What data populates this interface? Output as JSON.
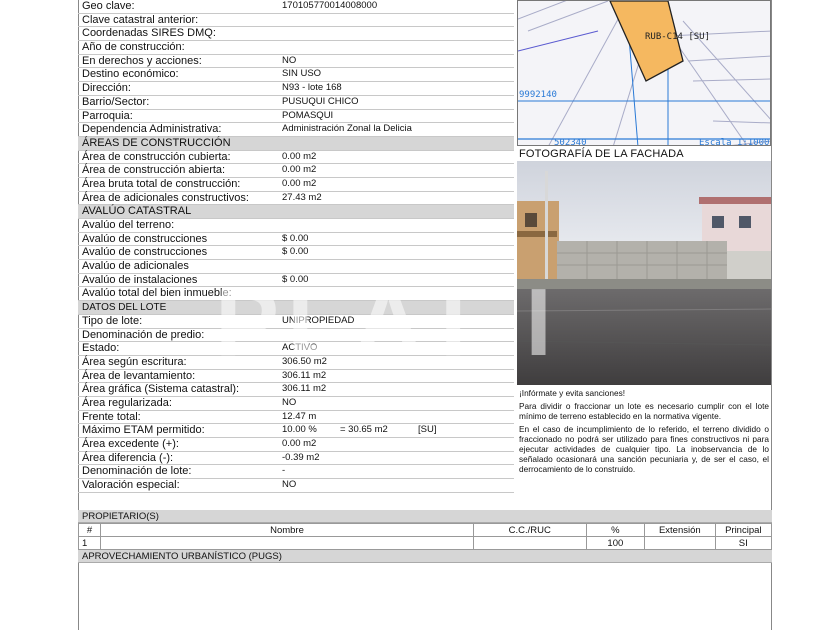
{
  "general_rows": [
    {
      "label": "Geo clave:",
      "value": "170105770014008000"
    },
    {
      "label": "Clave catastral anterior:",
      "value": ""
    },
    {
      "label": "Coordenadas SIRES DMQ:",
      "value": ""
    },
    {
      "label": "Año de construcción:",
      "value": ""
    },
    {
      "label": "En derechos y acciones:",
      "value": "NO"
    },
    {
      "label": "Destino económico:",
      "value": "SIN USO"
    },
    {
      "label": "Dirección:",
      "value": "N93  - lote 168"
    },
    {
      "label": "Barrio/Sector:",
      "value": "PUSUQUI CHICO"
    },
    {
      "label": "Parroquia:",
      "value": "POMASQUI"
    },
    {
      "label": "Dependencia Administrativa:",
      "value": "Administración Zonal la Delicia"
    }
  ],
  "construccion": {
    "title": "ÁREAS DE CONSTRUCCIÓN",
    "rows": [
      {
        "label": "Área de construcción cubierta:",
        "value": "0.00 m2"
      },
      {
        "label": "Área de construcción abierta:",
        "value": "0.00 m2"
      },
      {
        "label": "Área bruta total de construcción:",
        "value": "0.00 m2"
      },
      {
        "label": "Área de adicionales constructivos:",
        "value": "27.43 m2"
      }
    ]
  },
  "avaluo": {
    "title": "AVALÚO CATASTRAL",
    "rows": [
      {
        "label": "Avalúo del terreno:",
        "value": ""
      },
      {
        "label": "Avalúo de construcciones",
        "value": "$ 0.00"
      },
      {
        "label": "Avalúo de construcciones",
        "value": "$ 0.00"
      },
      {
        "label": "Avalúo de adicionales",
        "value": ""
      },
      {
        "label": "Avalúo de instalaciones",
        "value": "$ 0.00"
      },
      {
        "label": "Avalúo total del bien inmueble:",
        "value": ""
      }
    ]
  },
  "lote": {
    "title": "DATOS DEL LOTE",
    "rows": [
      {
        "label": "Tipo de lote:",
        "value": "UNIPROPIEDAD"
      },
      {
        "label": "Denominación de predio:",
        "value": ""
      },
      {
        "label": "Estado:",
        "value": "ACTIVO"
      },
      {
        "label": "Área según escritura:",
        "value": "306.50 m2"
      },
      {
        "label": "Área de levantamiento:",
        "value": "306.11 m2"
      },
      {
        "label": "Área gráfica (Sistema catastral):",
        "value": "306.11 m2"
      },
      {
        "label": "Área regularizada:",
        "value": "NO"
      },
      {
        "label": "Frente total:",
        "value": "12.47 m"
      },
      {
        "label": "Máximo ETAM permitido:",
        "value": "10.00 %",
        "extra1": "= 30.65 m2",
        "extra2": "[SU]"
      },
      {
        "label": "Área excedente (+):",
        "value": "0.00 m2"
      },
      {
        "label": "Área diferencia (-):",
        "value": "-0.39 m2"
      },
      {
        "label": "Denominación de lote:",
        "value": "-"
      },
      {
        "label": "Valoración especial:",
        "value": "NO"
      }
    ]
  },
  "map": {
    "parcel_label": "RUB-C14 [SU]",
    "coord_y": "9992140",
    "coord_x": "502340",
    "scale": "Escala 1:1000",
    "parcel_color": "#f5b860"
  },
  "photo": {
    "title": "FOTOGRAFÍA DE LA FACHADA"
  },
  "notice": {
    "heading": "¡Infórmate y evita sanciones!",
    "p1": "Para dividir o fraccionar un lote es necesario cumplir con el lote mínimo de terreno establecido en la normativa vigente.",
    "p2": "En el caso de incumplimiento de lo referido, el terreno dividido o fraccionado no podrá ser utilizado para fines constructivos ni para ejecutar actividades de cualquier tipo. La inobservancia de lo señalado ocasionará una sanción pecuniaria y, de ser el caso, el derrocamiento de lo construido."
  },
  "propietarios": {
    "title": "PROPIETARIO(S)",
    "headers": [
      "#",
      "Nombre",
      "C.C./RUC",
      "%",
      "Extensión",
      "Principal"
    ],
    "rows": [
      [
        "1",
        "",
        "",
        "100",
        "",
        "SI"
      ]
    ]
  },
  "pugs": {
    "title": "APROVECHAMIENTO URBANÍSTICO (PUGS)"
  }
}
